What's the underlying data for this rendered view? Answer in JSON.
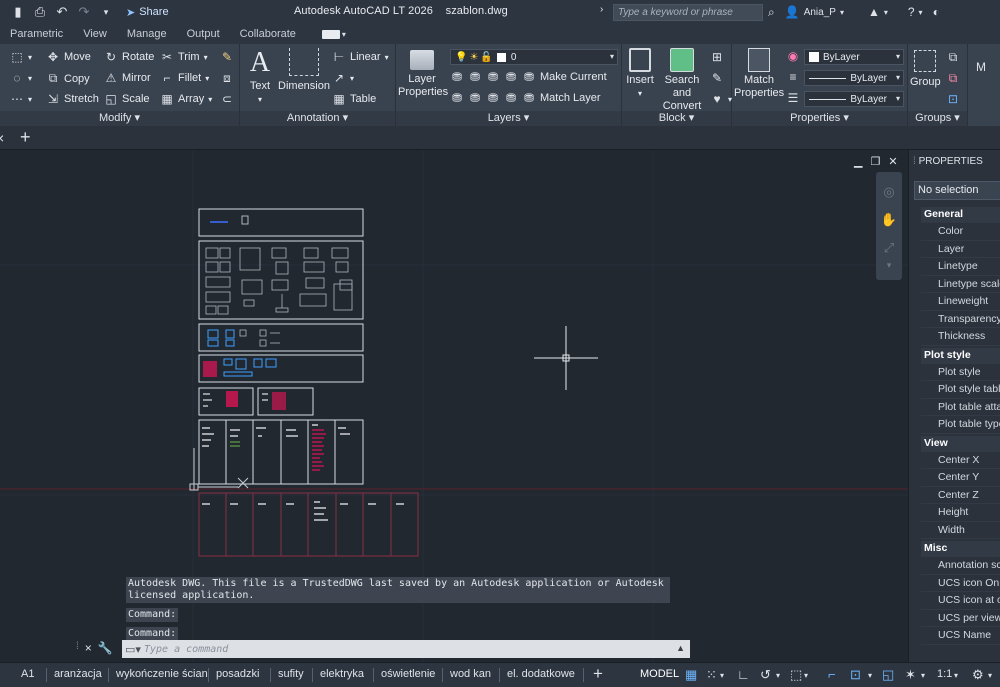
{
  "titlebar": {
    "app_title": "Autodesk AutoCAD LT 2026",
    "file_name": "szablon.dwg",
    "share_label": "Share",
    "search_placeholder": "Type a keyword or phrase",
    "user_name": "Ania_P"
  },
  "ribbon_tabs": [
    "Parametric",
    "View",
    "Manage",
    "Output",
    "Collaborate"
  ],
  "ribbon": {
    "modify": {
      "label": "Modify",
      "move": "Move",
      "rotate": "Rotate",
      "trim": "Trim",
      "copy": "Copy",
      "mirror": "Mirror",
      "fillet": "Fillet",
      "stretch": "Stretch",
      "scale": "Scale",
      "array": "Array"
    },
    "annotation": {
      "label": "Annotation",
      "text": "Text",
      "dimension": "Dimension",
      "linear": "Linear",
      "table": "Table"
    },
    "layers": {
      "label": "Layers",
      "layer_properties_1": "Layer",
      "layer_properties_2": "Properties",
      "current_layer": "0",
      "make_current": "Make Current",
      "match_layer": "Match Layer"
    },
    "block": {
      "label": "Block",
      "insert": "Insert",
      "search_convert_1": "Search and",
      "search_convert_2": "Convert"
    },
    "properties": {
      "label": "Properties",
      "match_1": "Match",
      "match_2": "Properties",
      "color": "ByLayer",
      "linetype": "ByLayer",
      "lineweight": "ByLayer"
    },
    "groups": {
      "label": "Groups",
      "group": "Group"
    }
  },
  "command_line": {
    "history": "Autodesk DWG.  This file is a TrustedDWG last saved by an Autodesk application or Autodesk licensed application.",
    "prompt_1": "Command:",
    "prompt_2": "Command:",
    "placeholder": "Type a command"
  },
  "properties_palette": {
    "title": "PROPERTIES",
    "selection": "No selection",
    "sections": [
      {
        "name": "General",
        "items": [
          "Color",
          "Layer",
          "Linetype",
          "Linetype scale",
          "Lineweight",
          "Transparency",
          "Thickness"
        ]
      },
      {
        "name": "Plot style",
        "items": [
          "Plot style",
          "Plot style table",
          "Plot table attached to",
          "Plot table type"
        ]
      },
      {
        "name": "View",
        "items": [
          "Center X",
          "Center Y",
          "Center Z",
          "Height",
          "Width"
        ]
      },
      {
        "name": "Misc",
        "items": [
          "Annotation scale",
          "UCS icon On",
          "UCS icon at origin",
          "UCS per viewport",
          "UCS Name"
        ]
      }
    ]
  },
  "layout_tabs": [
    "A1",
    "aranżacja",
    "wykończenie ścian",
    "posadzki",
    "sufity",
    "elektryka",
    "oświetlenie",
    "wod kan",
    "el. dodatkowe"
  ],
  "status": {
    "model": "MODEL",
    "scale": "1:1"
  },
  "colors": {
    "ribbon_bg": "#39424f",
    "canvas_bg": "#212830",
    "accent_blue": "#6fb6ff"
  }
}
